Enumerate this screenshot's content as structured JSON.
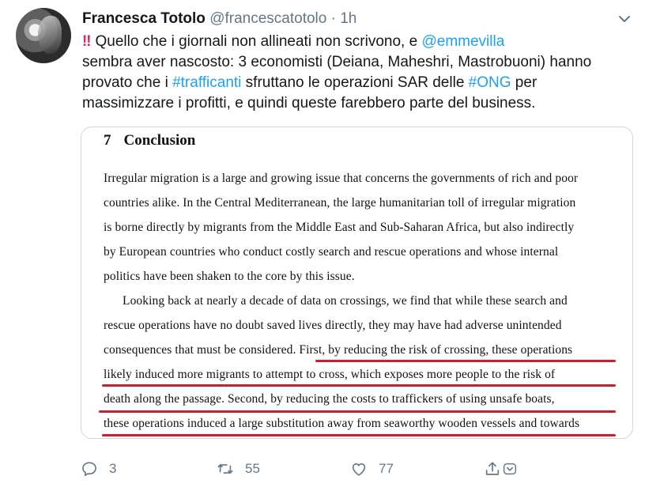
{
  "author": {
    "name": "Francesca Totolo",
    "handle": "@francescatotolo",
    "separator": "·",
    "time": "1h"
  },
  "tweet": {
    "bang": "‼",
    "l1_a": "Quello che i giornali non allineati non scrivono, e ",
    "l1_mention": "@emmevilla",
    "l2": " sembra aver nascosto: 3 economisti (Deiana, Maheshri, Mastrobuoni) hanno",
    "l3_a": "provato che i ",
    "l3_tag1": "#trafficanti",
    "l3_b": " sfruttano le operazioni SAR delle ",
    "l3_tag2": "#ONG",
    "l3_c": " per",
    "l4": "massimizzare i profitti, e quindi queste farebbero parte del business."
  },
  "document": {
    "section_number": "7",
    "section_title": "Conclusion",
    "lines": [
      "Irregular migration is a large and growing issue that concerns the governments of rich and poor",
      "countries alike. In the Central Mediterranean, the large humanitarian toll of irregular migration",
      "is borne directly by migrants from the Middle East and Sub-Saharan Africa, but also indirectly",
      "by European countries who conduct costly search and rescue operations and whose internal",
      "politics have been shaken to the core by this issue.",
      "Looking back at nearly a decade of data on crossings, we find that while these search and",
      "rescue operations have no doubt saved lives directly, they may have had adverse unintended",
      "consequences that must be considered. First, by reducing the risk of crossing, these operations",
      "likely induced more migrants to attempt to cross, which exposes more people to the risk of",
      "death along the passage. Second, by reducing the costs to traffickers of using unsafe boats,",
      "these operations induced a large substitution away from seaworthy wooden vessels and towards"
    ]
  },
  "actions": {
    "replies": "3",
    "retweets": "55",
    "likes": "77"
  },
  "colors": {
    "link": "#1da1f2",
    "muted": "#657786",
    "underline": "#d41b2c"
  }
}
